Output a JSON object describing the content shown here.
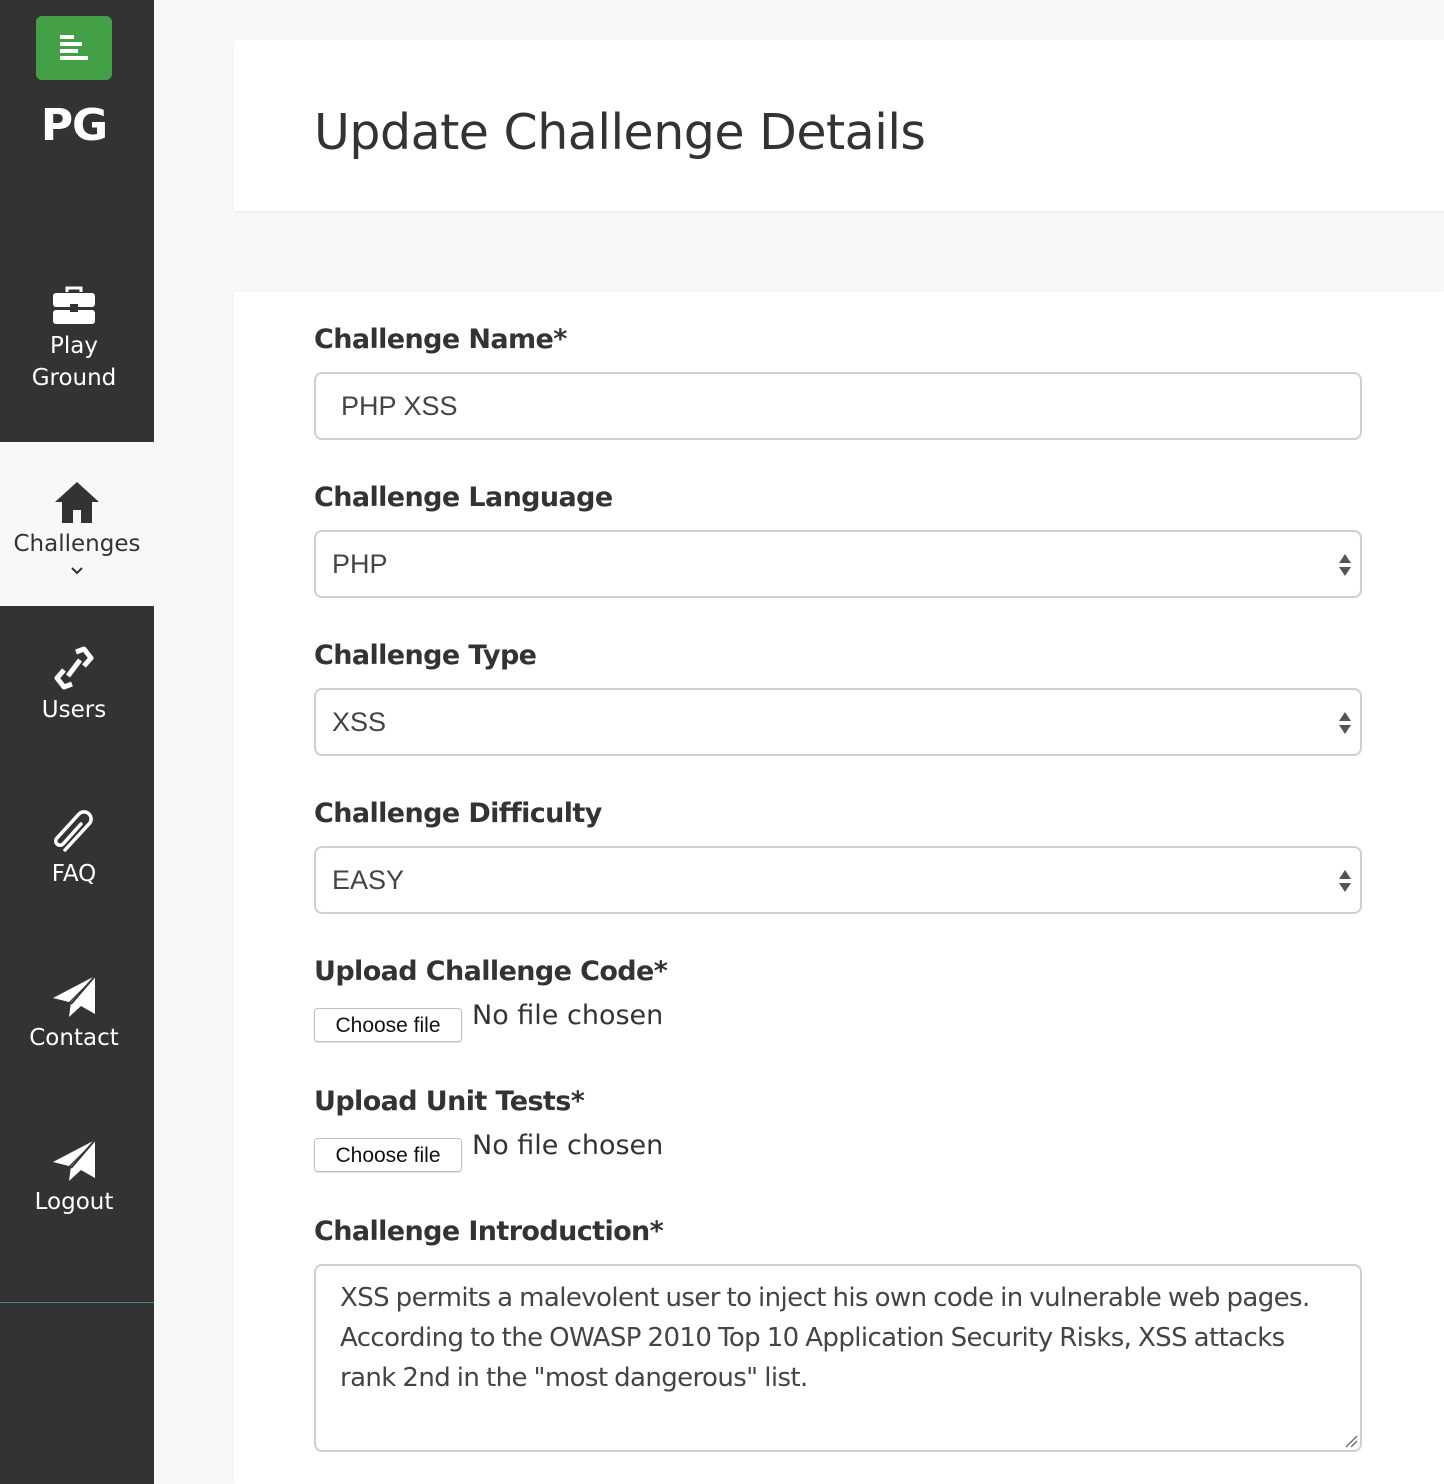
{
  "sidebar": {
    "brand": "PG",
    "logo_icon": "align-left-icon",
    "items": [
      {
        "label_line1": "Play",
        "label_line2": "Ground",
        "icon": "briefcase-icon",
        "active": false
      },
      {
        "label": "Challenges",
        "icon": "home-icon",
        "active": true,
        "chevron": "⌄"
      },
      {
        "label": "Users",
        "icon": "link-icon",
        "active": false
      },
      {
        "label": "FAQ",
        "icon": "paperclip-icon",
        "active": false
      },
      {
        "label": "Contact",
        "icon": "paper-plane-icon",
        "active": false
      },
      {
        "label": "Logout",
        "icon": "paper-plane-icon",
        "active": false
      }
    ]
  },
  "header": {
    "title": "Update Challenge Details"
  },
  "form": {
    "name": {
      "label": "Challenge Name*",
      "value": "PHP XSS"
    },
    "language": {
      "label": "Challenge Language",
      "selected": "PHP"
    },
    "type": {
      "label": "Challenge Type",
      "selected": "XSS"
    },
    "difficulty": {
      "label": "Challenge Difficulty",
      "selected": "EASY"
    },
    "code_upload": {
      "label": "Upload Challenge Code*",
      "button": "Choose file",
      "status": "No file chosen"
    },
    "tests_upload": {
      "label": "Upload Unit Tests*",
      "button": "Choose file",
      "status": "No file chosen"
    },
    "introduction": {
      "label": "Challenge Introduction*",
      "value": "XSS permits a malevolent user to inject his own code in vulnerable web pages. According to the OWASP 2010 Top 10 Application Security Risks, XSS attacks rank 2nd in the \"most dangerous\" list."
    }
  },
  "colors": {
    "sidebar_bg": "#333333",
    "logo_green": "#43a047",
    "page_bg": "#f8f8f8",
    "text": "#333333"
  }
}
